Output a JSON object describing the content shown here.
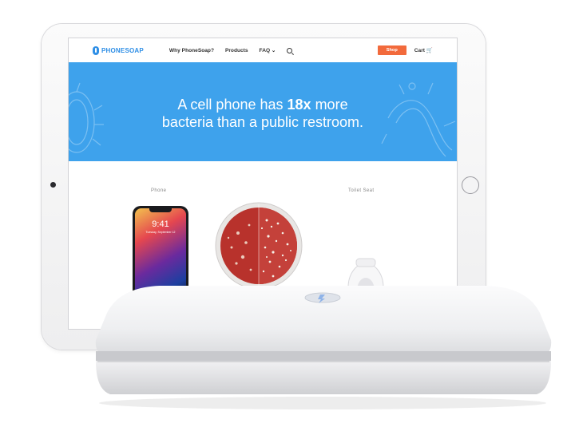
{
  "navbar": {
    "logo_text": "PHONESOAP",
    "links": [
      "Why PhoneSoap?",
      "Products",
      "FAQ ⌄"
    ],
    "shop_label": "Shop",
    "cart_label": "Cart 🛒"
  },
  "hero": {
    "line1_prefix": "A cell phone has ",
    "line1_bold": "18x",
    "line1_suffix": " more",
    "line2": "bacteria than a public restroom."
  },
  "comparison": {
    "phone_label": "Phone",
    "toilet_label": "Toilet Seat"
  },
  "iphone": {
    "time": "9:41",
    "date": "Tuesday, September 12"
  },
  "colors": {
    "hero_blue": "#3ea2ec",
    "shop_orange": "#f26a3c",
    "brand_blue": "#2f8fe6",
    "agar_red": "#b8322c"
  }
}
